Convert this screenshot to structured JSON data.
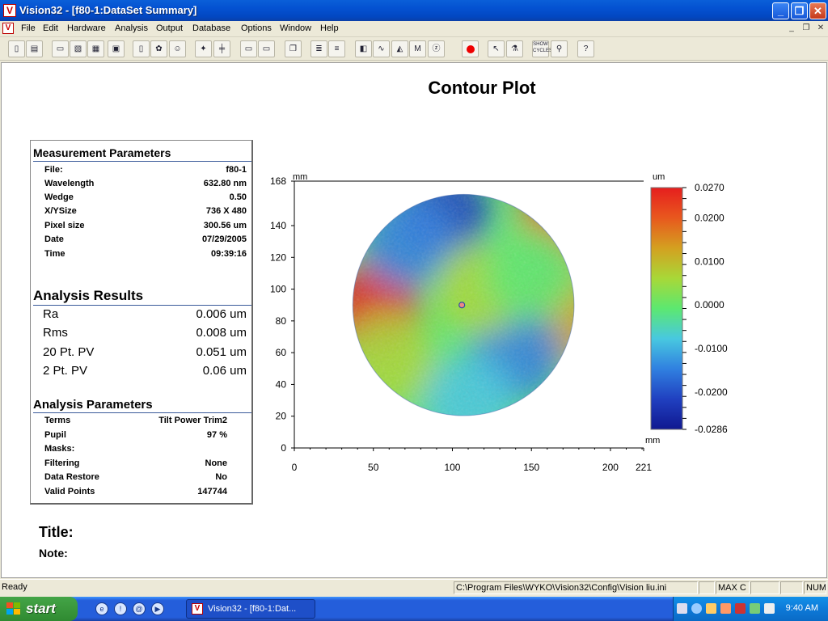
{
  "window": {
    "title": "Vision32 - [f80-1:DataSet Summary]",
    "app_icon": "V",
    "controls": [
      "minimize",
      "restore",
      "close"
    ]
  },
  "menu": {
    "items": [
      "File",
      "Edit",
      "Hardware",
      "Analysis",
      "Output",
      "Database",
      "Options",
      "Window",
      "Help"
    ]
  },
  "toolbar": {
    "icons": [
      "new-icon",
      "open-doc-icon",
      "open-folder-icon",
      "print-preview-icon",
      "print-icon",
      "save-icon",
      "page-icon",
      "color-wheel-icon",
      "mask-icon",
      "star-icon",
      "ruler-icon",
      "window-icon",
      "window-2-icon",
      "copy-icon",
      "stack-icon",
      "layers-icon",
      "contour-icon",
      "profile-icon",
      "3d-icon",
      "m-icon",
      "z-icon",
      "record-icon",
      "pointer-icon",
      "flask-icon",
      "shortcuts-icon",
      "zoom-icon",
      "help-icon"
    ],
    "shortcuts_label": "SHOW CYCLES"
  },
  "document": {
    "plot_title": "Contour Plot",
    "measurement_parameters": {
      "heading": "Measurement Parameters",
      "rows": [
        {
          "label": "File:",
          "value": "f80-1"
        },
        {
          "label": "Wavelength",
          "value": "632.80 nm"
        },
        {
          "label": "Wedge",
          "value": "0.50"
        },
        {
          "label": "X/YSize",
          "value": "736 X 480"
        },
        {
          "label": "Pixel size",
          "value": "300.56 um"
        },
        {
          "label": "Date",
          "value": "07/29/2005"
        },
        {
          "label": "Time",
          "value": "09:39:16"
        }
      ]
    },
    "analysis_results": {
      "heading": "Analysis Results",
      "rows": [
        {
          "label": "Ra",
          "value": "0.006 um"
        },
        {
          "label": "Rms",
          "value": "0.008 um"
        },
        {
          "label": "20 Pt. PV",
          "value": "0.051 um"
        },
        {
          "label": "2 Pt. PV",
          "value": "0.06 um"
        }
      ]
    },
    "analysis_parameters": {
      "heading": "Analysis Parameters",
      "rows": [
        {
          "label": "Terms",
          "value": "Tilt Power Trim2"
        },
        {
          "label": "Pupil",
          "value": "97 %"
        },
        {
          "label": "Masks:",
          "value": ""
        },
        {
          "label": "Filtering",
          "value": "None"
        },
        {
          "label": "Data Restore",
          "value": "No"
        },
        {
          "label": "Valid Points",
          "value": "147744"
        }
      ]
    },
    "title_label": "Title:",
    "note_label": "Note:"
  },
  "chart_data": {
    "type": "heatmap",
    "title": "Contour Plot",
    "x_unit": "mm",
    "y_unit": "mm",
    "xlim": [
      0,
      221
    ],
    "ylim": [
      0,
      168
    ],
    "x_ticks": [
      "0",
      "50",
      "100",
      "150",
      "200",
      "221"
    ],
    "y_ticks": [
      "0",
      "20",
      "40",
      "60",
      "80",
      "100",
      "120",
      "140",
      "168"
    ],
    "colorbar": {
      "unit": "um",
      "min": -0.0286,
      "max": 0.027,
      "tick_labels": [
        "0.0270",
        "0.0200",
        "0.0100",
        "0.0000",
        "-0.0100",
        "-0.0200",
        "-0.0286"
      ],
      "tick_values": [
        0.027,
        0.02,
        0.01,
        0.0,
        -0.01,
        -0.02,
        -0.0286
      ],
      "colors": [
        "#e61e1e",
        "#e8581e",
        "#d4a020",
        "#a8d838",
        "#5ce870",
        "#48c8e0",
        "#3080e0",
        "#2040c0",
        "#101890"
      ]
    },
    "aperture": {
      "center_x_mm": 107,
      "center_y_mm": 90,
      "radius_mm": 70
    },
    "regions": [
      {
        "x": 172,
        "y": 145,
        "value": 0.02
      },
      {
        "x": 50,
        "y": 88,
        "value": 0.024
      },
      {
        "x": 175,
        "y": 82,
        "value": 0.014
      },
      {
        "x": 95,
        "y": 148,
        "value": -0.022
      },
      {
        "x": 72,
        "y": 130,
        "value": -0.012
      },
      {
        "x": 140,
        "y": 58,
        "value": -0.014
      },
      {
        "x": 118,
        "y": 100,
        "value": 0.008
      },
      {
        "x": 110,
        "y": 30,
        "value": -0.006
      },
      {
        "x": 60,
        "y": 55,
        "value": 0.004
      },
      {
        "x": 150,
        "y": 110,
        "value": 0.002
      }
    ]
  },
  "statusbar": {
    "status": "Ready",
    "path": "C:\\Program Files\\WYKO\\Vision32\\Config\\Vision liu.ini",
    "max": "MAX C",
    "num": "NUM"
  },
  "taskbar": {
    "start_label": "start",
    "task_label": "Vision32 - [f80-1:Dat...",
    "clock": "9:40 AM"
  }
}
